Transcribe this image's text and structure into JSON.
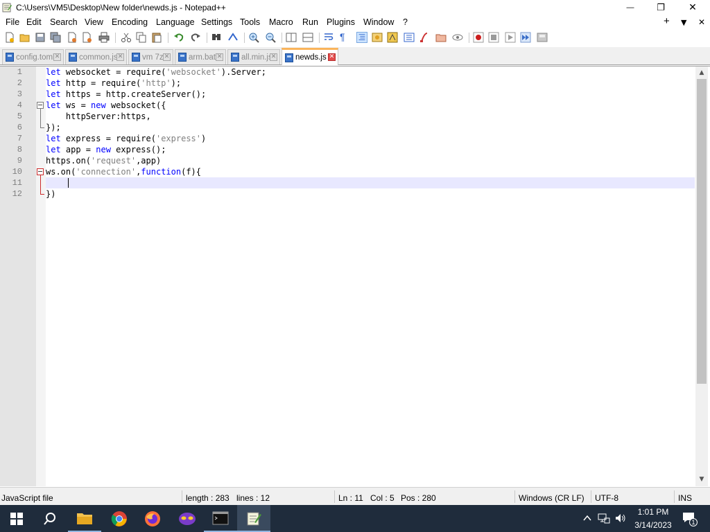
{
  "window": {
    "title": "C:\\Users\\VM5\\Desktop\\New folder\\newds.js - Notepad++",
    "minimize_glyph": "—",
    "maximize_glyph": "❐",
    "close_glyph": "✕"
  },
  "menu": {
    "items": [
      "File",
      "Edit",
      "Search",
      "View",
      "Encoding",
      "Language",
      "Settings",
      "Tools",
      "Macro",
      "Run",
      "Plugins",
      "Window",
      "?"
    ],
    "right_add": "+",
    "right_dropdown": "▼",
    "right_close": "✕"
  },
  "tabs": [
    {
      "label": "config.toml",
      "active": false
    },
    {
      "label": "common.js",
      "active": false
    },
    {
      "label": "vm 7z",
      "active": false
    },
    {
      "label": "arm.bat",
      "active": false
    },
    {
      "label": "all.min.js",
      "active": false
    },
    {
      "label": "newds.js",
      "active": true
    }
  ],
  "editor": {
    "line_numbers": [
      "1",
      "2",
      "3",
      "4",
      "5",
      "6",
      "7",
      "8",
      "9",
      "10",
      "11",
      "12"
    ],
    "lines": [
      [
        {
          "t": "let",
          "c": "kw"
        },
        {
          "t": " websocket = require("
        },
        {
          "t": "'websocket'",
          "c": "str"
        },
        {
          "t": ").Server;"
        }
      ],
      [
        {
          "t": "let",
          "c": "kw"
        },
        {
          "t": " http = require("
        },
        {
          "t": "'http'",
          "c": "str"
        },
        {
          "t": ");"
        }
      ],
      [
        {
          "t": "let",
          "c": "kw"
        },
        {
          "t": " https = http.createServer();"
        }
      ],
      [
        {
          "t": "let",
          "c": "kw"
        },
        {
          "t": " ws = "
        },
        {
          "t": "new",
          "c": "kw"
        },
        {
          "t": " websocket({"
        }
      ],
      [
        {
          "t": "    httpServer:https,"
        }
      ],
      [
        {
          "t": "});"
        }
      ],
      [
        {
          "t": "let",
          "c": "kw"
        },
        {
          "t": " express = require("
        },
        {
          "t": "'express'",
          "c": "str"
        },
        {
          "t": ")"
        }
      ],
      [
        {
          "t": "let",
          "c": "kw"
        },
        {
          "t": " app = "
        },
        {
          "t": "new",
          "c": "kw"
        },
        {
          "t": " express();"
        }
      ],
      [
        {
          "t": "https.on("
        },
        {
          "t": "'request'",
          "c": "str"
        },
        {
          "t": ",app)"
        }
      ],
      [
        {
          "t": "ws.on("
        },
        {
          "t": "'connection'",
          "c": "str"
        },
        {
          "t": ","
        },
        {
          "t": "function",
          "c": "kw"
        },
        {
          "t": "(f){"
        }
      ],
      [
        {
          "t": ""
        }
      ],
      [
        {
          "t": "})"
        }
      ]
    ]
  },
  "statusbar": {
    "file_type": "JavaScript file",
    "length": "length : 283",
    "lines": "lines : 12",
    "ln": "Ln : 11",
    "col": "Col : 5",
    "pos": "Pos : 280",
    "eol": "Windows (CR LF)",
    "encoding": "UTF-8",
    "mode": "INS"
  },
  "taskbar": {
    "time": "1:01 PM",
    "date": "3/14/2023",
    "notification_count": "1"
  },
  "colors": {
    "keyword": "#0000ff",
    "string": "#808080",
    "active_tab_accent": "#fab45a",
    "current_line": "#e8e8ff",
    "taskbar": "#1f2c3c"
  }
}
